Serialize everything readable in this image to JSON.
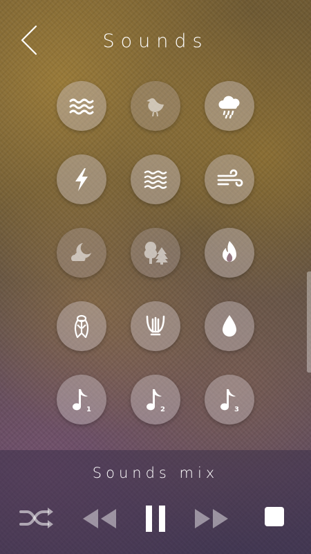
{
  "header": {
    "title": "Sounds"
  },
  "sounds": [
    {
      "icon": "waves-icon",
      "active": true
    },
    {
      "icon": "bird-icon",
      "active": false
    },
    {
      "icon": "rain-cloud-icon",
      "active": true
    },
    {
      "icon": "thunder-icon",
      "active": true
    },
    {
      "icon": "water-icon",
      "active": true
    },
    {
      "icon": "wind-icon",
      "active": true
    },
    {
      "icon": "night-icon",
      "active": false
    },
    {
      "icon": "forest-icon",
      "active": false
    },
    {
      "icon": "fire-icon",
      "active": true
    },
    {
      "icon": "cicada-icon",
      "active": true
    },
    {
      "icon": "harp-icon",
      "active": true
    },
    {
      "icon": "drop-icon",
      "active": true
    },
    {
      "icon": "music-note-1-icon",
      "active": true,
      "number": "1"
    },
    {
      "icon": "music-note-2-icon",
      "active": true,
      "number": "2"
    },
    {
      "icon": "music-note-3-icon",
      "active": true,
      "number": "3"
    }
  ],
  "player": {
    "mix_label": "Sounds mix",
    "controls": [
      "shuffle-icon",
      "rewind-icon",
      "pause-icon",
      "fast-forward-icon",
      "stop-icon"
    ]
  }
}
